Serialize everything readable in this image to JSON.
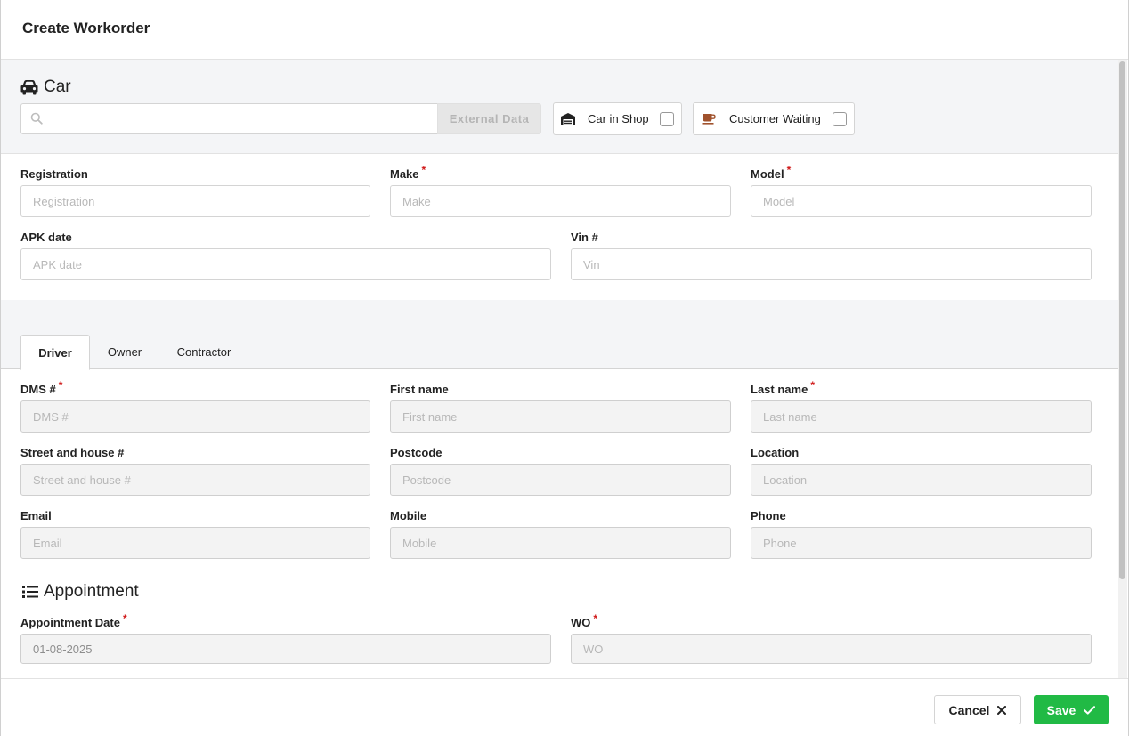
{
  "modal": {
    "title": "Create Workorder"
  },
  "car_section": {
    "heading": "Car",
    "search_placeholder": "",
    "external_data_label": "External Data",
    "car_in_shop_label": "Car in Shop",
    "customer_waiting_label": "Customer Waiting",
    "car_in_shop_checked": false,
    "customer_waiting_checked": false
  },
  "car_fields": {
    "registration": {
      "label": "Registration",
      "placeholder": "Registration",
      "required": false
    },
    "make": {
      "label": "Make",
      "placeholder": "Make",
      "required": true
    },
    "model": {
      "label": "Model",
      "placeholder": "Model",
      "required": true
    },
    "apk_date": {
      "label": "APK date",
      "placeholder": "APK date",
      "required": false
    },
    "vin": {
      "label": "Vin #",
      "placeholder": "Vin",
      "required": false
    }
  },
  "tabs": [
    {
      "label": "Driver",
      "active": true
    },
    {
      "label": "Owner",
      "active": false
    },
    {
      "label": "Contractor",
      "active": false
    }
  ],
  "driver_fields": {
    "dms": {
      "label": "DMS #",
      "placeholder": "DMS #",
      "required": true
    },
    "first_name": {
      "label": "First name",
      "placeholder": "First name",
      "required": false
    },
    "last_name": {
      "label": "Last name",
      "placeholder": "Last name",
      "required": true
    },
    "street": {
      "label": "Street and house #",
      "placeholder": "Street and house #",
      "required": false
    },
    "postcode": {
      "label": "Postcode",
      "placeholder": "Postcode",
      "required": false
    },
    "location": {
      "label": "Location",
      "placeholder": "Location",
      "required": false
    },
    "email": {
      "label": "Email",
      "placeholder": "Email",
      "required": false
    },
    "mobile": {
      "label": "Mobile",
      "placeholder": "Mobile",
      "required": false
    },
    "phone": {
      "label": "Phone",
      "placeholder": "Phone",
      "required": false
    }
  },
  "appointment_section": {
    "heading": "Appointment",
    "appointment_date": {
      "label": "Appointment Date",
      "value": "01-08-2025",
      "required": true
    },
    "wo": {
      "label": "WO",
      "placeholder": "WO",
      "required": true
    }
  },
  "footer": {
    "cancel_label": "Cancel",
    "save_label": "Save"
  },
  "colors": {
    "primary_save": "#21ba45",
    "required_mark": "#d01919",
    "section_background": "#f4f5f7",
    "coffee_icon": "#a0522d"
  },
  "icons": {
    "car_heading": "car-icon",
    "search": "search-icon",
    "garage": "garage-icon",
    "coffee": "coffee-icon",
    "appointment_heading": "list-icon",
    "cancel": "close-icon",
    "save": "check-icon"
  }
}
